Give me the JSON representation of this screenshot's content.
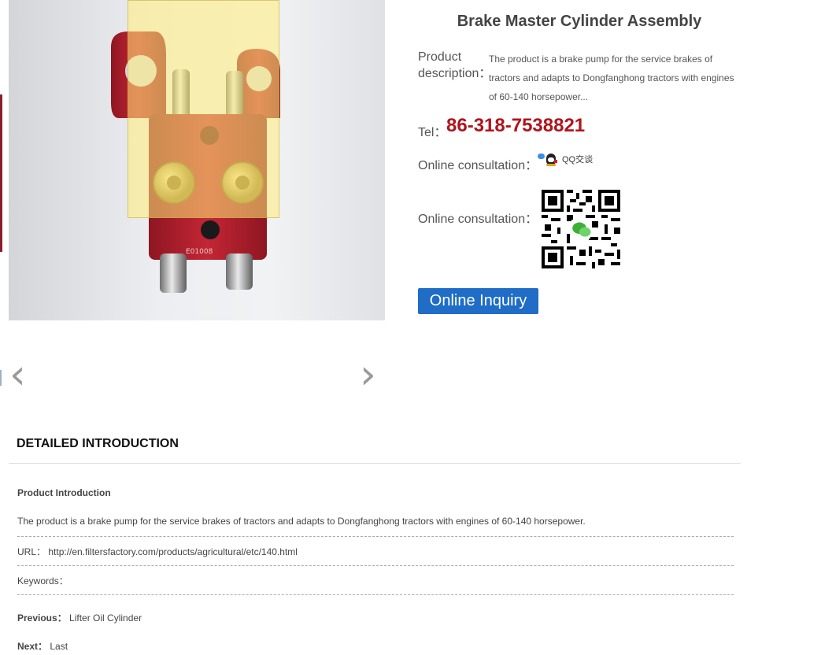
{
  "product": {
    "title": "Brake Master Cylinder Assembly",
    "description_label": "Product description：",
    "description": "The product is a brake pump for the service brakes of tractors and adapts to Dongfanghong tractors with engines of 60-140 horsepower...",
    "tel_label": "Tel：",
    "tel": "86-318-7538821",
    "consult_label_1": "Online consultation：",
    "qq_text": "QQ交谈",
    "consult_label_2": "Online consultation：",
    "inquiry_button": "Online Inquiry"
  },
  "gallery": {
    "prev_glyph": "‹",
    "next_glyph": "›",
    "part_marking": "E01008"
  },
  "details": {
    "section_title": "DETAILED INTRODUCTION",
    "intro_heading": "Product Introduction",
    "intro_text": "The product is a brake pump for the service brakes of tractors and adapts to Dongfanghong tractors with engines of 60-140 horsepower.",
    "url_label": "URL：",
    "url": "http://en.filtersfactory.com/products/agricultural/etc/140.html",
    "keywords_label": "Keywords：",
    "previous_label": "Previous：",
    "previous": "Lifter Oil Cylinder",
    "next_label": "Next：",
    "next": "Last"
  },
  "colors": {
    "accent": "#1f6dc6",
    "tel": "#b0141b",
    "cylinder_red": "#b01e2a",
    "brass": "#c8a04a"
  }
}
